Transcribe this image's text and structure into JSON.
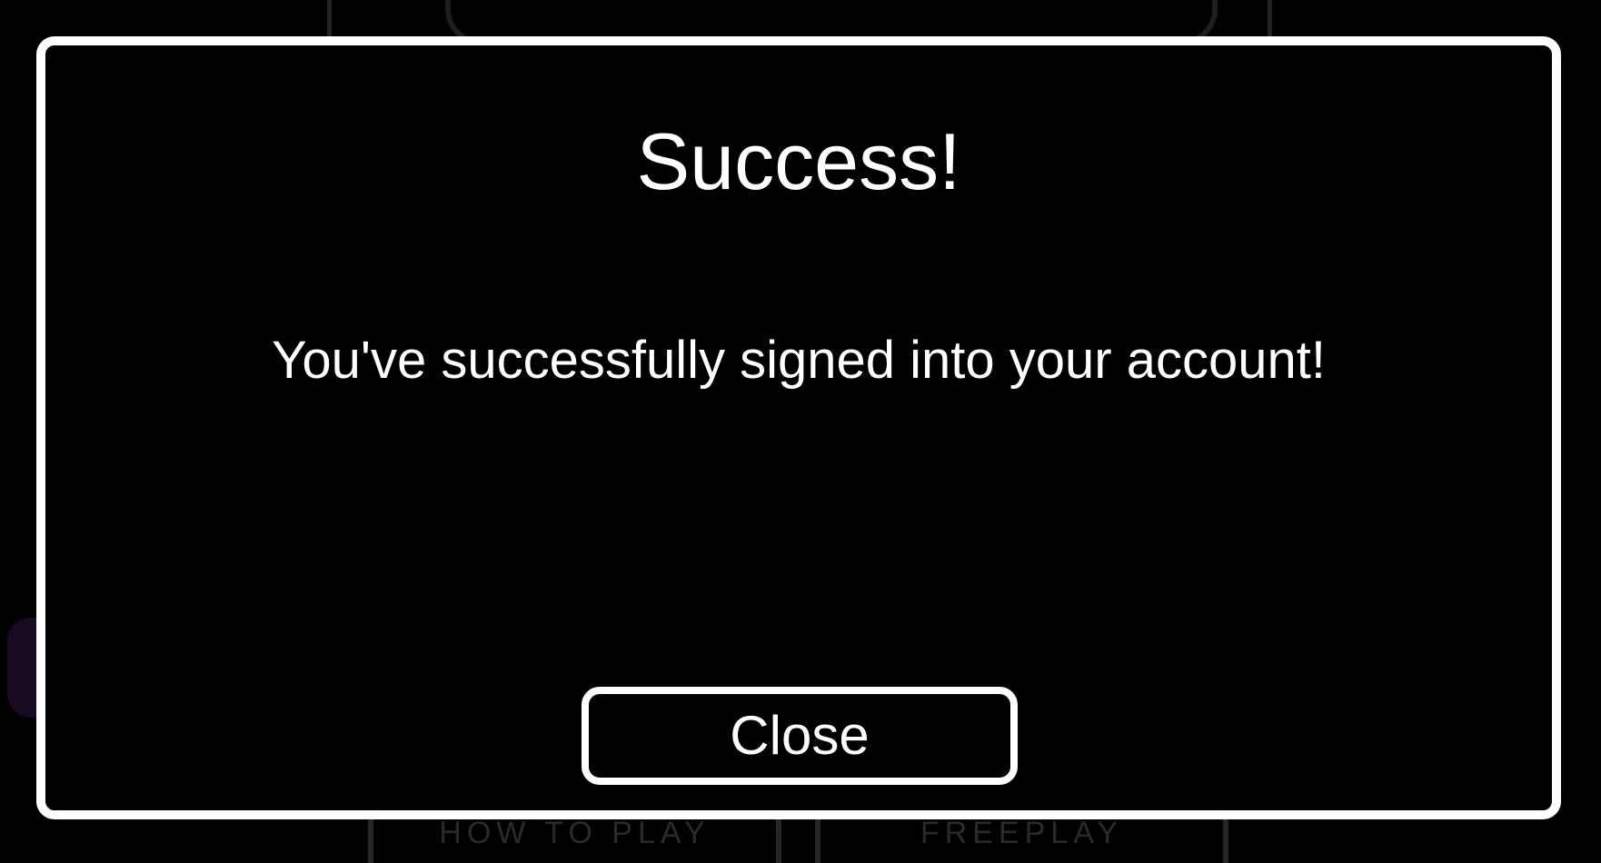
{
  "dialog": {
    "title": "Success!",
    "message": "You've successfully signed into your account!",
    "close_label": "Close"
  },
  "background_menu": {
    "buttons": [
      {
        "label": "HOW TO PLAY"
      },
      {
        "label": "FREEPLAY"
      }
    ]
  },
  "colors": {
    "background": "#000000",
    "modal_border": "#ffffff",
    "text": "#ffffff"
  }
}
